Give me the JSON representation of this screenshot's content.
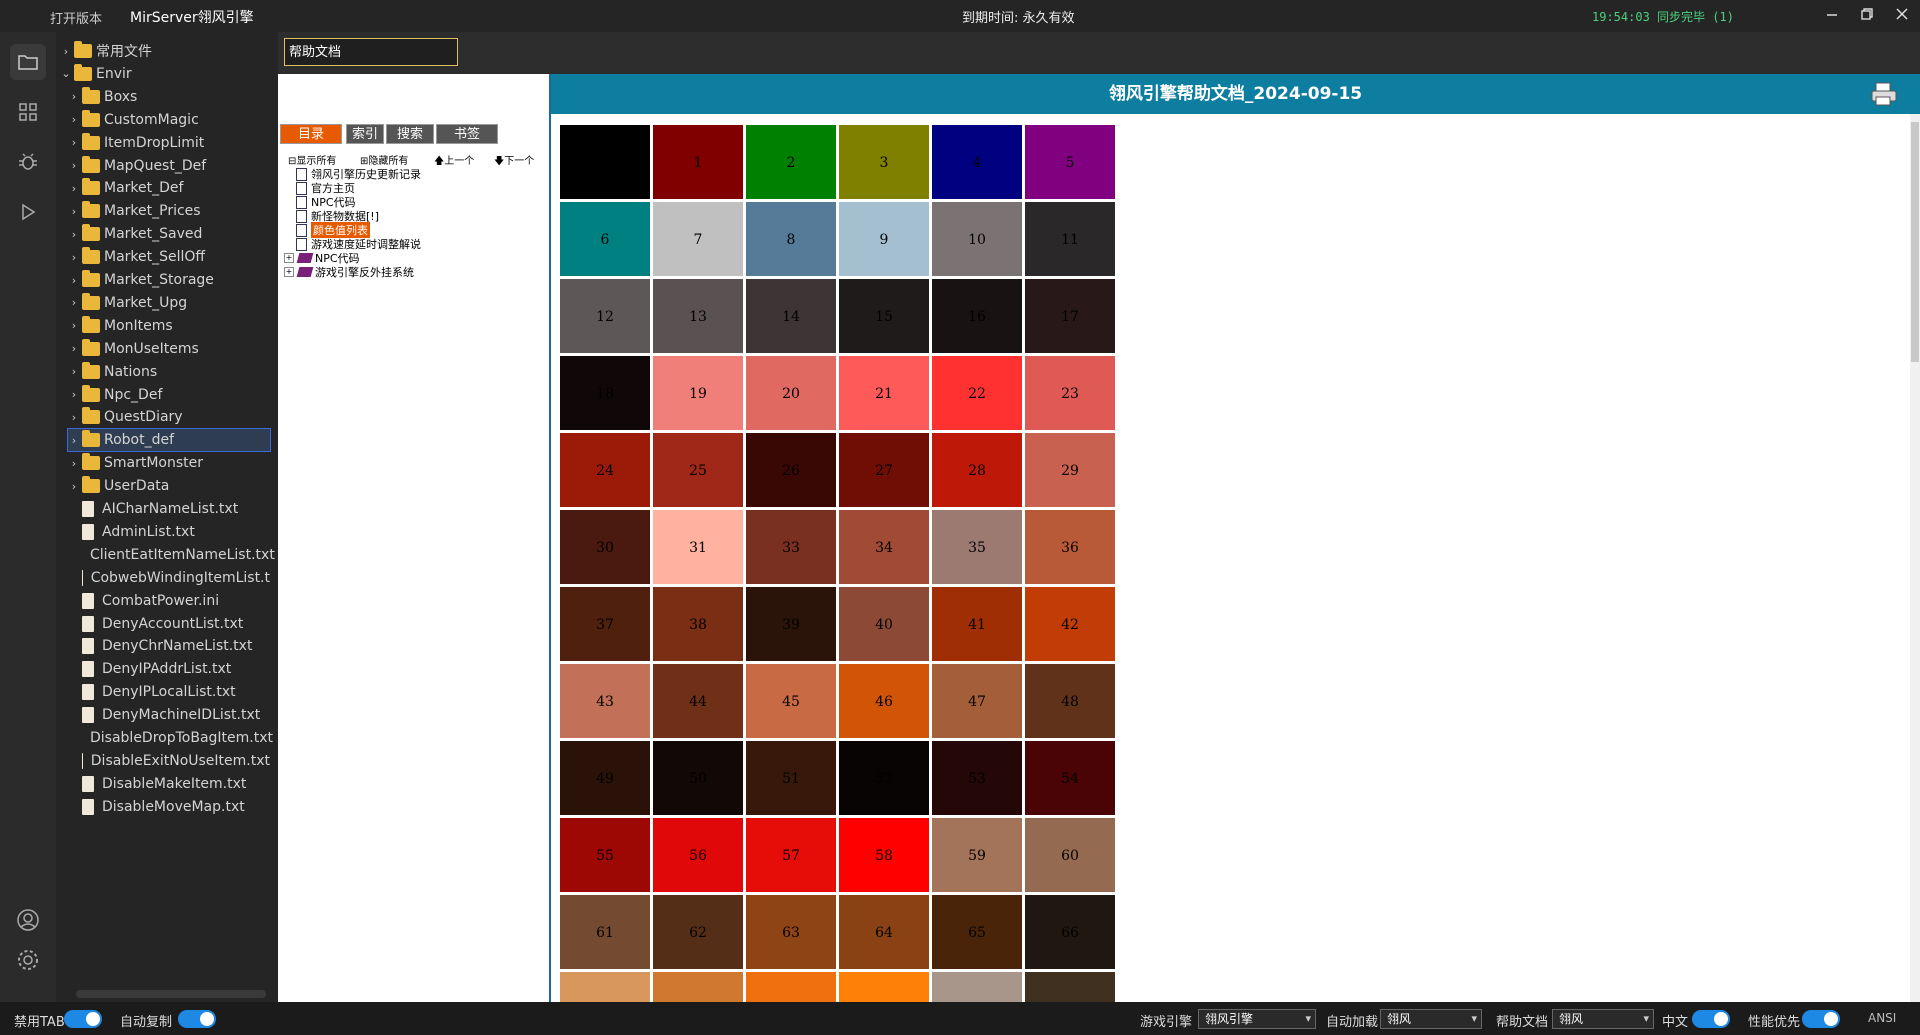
{
  "titlebar": {
    "open_version": "打开版本",
    "app_title": "MirServer翎风引擎",
    "expire": "到期时间: 永久有效",
    "sync_status": "19:54:03 同步完毕 (1)"
  },
  "explorer": {
    "items": [
      {
        "label": "常用文件",
        "type": "folder",
        "expanded": false,
        "depth": 0
      },
      {
        "label": "Envir",
        "type": "folder",
        "expanded": true,
        "depth": 0
      },
      {
        "label": "Boxs",
        "type": "folder",
        "depth": 1
      },
      {
        "label": "CustomMagic",
        "type": "folder",
        "depth": 1
      },
      {
        "label": "ItemDropLimit",
        "type": "folder",
        "depth": 1
      },
      {
        "label": "MapQuest_Def",
        "type": "folder",
        "depth": 1
      },
      {
        "label": "Market_Def",
        "type": "folder",
        "depth": 1
      },
      {
        "label": "Market_Prices",
        "type": "folder",
        "depth": 1
      },
      {
        "label": "Market_Saved",
        "type": "folder",
        "depth": 1
      },
      {
        "label": "Market_SellOff",
        "type": "folder",
        "depth": 1
      },
      {
        "label": "Market_Storage",
        "type": "folder",
        "depth": 1
      },
      {
        "label": "Market_Upg",
        "type": "folder",
        "depth": 1
      },
      {
        "label": "MonItems",
        "type": "folder",
        "depth": 1
      },
      {
        "label": "MonUseItems",
        "type": "folder",
        "depth": 1
      },
      {
        "label": "Nations",
        "type": "folder",
        "depth": 1
      },
      {
        "label": "Npc_Def",
        "type": "folder",
        "depth": 1
      },
      {
        "label": "QuestDiary",
        "type": "folder",
        "depth": 1
      },
      {
        "label": "Robot_def",
        "type": "folder",
        "depth": 1,
        "selected": true
      },
      {
        "label": "SmartMonster",
        "type": "folder",
        "depth": 1
      },
      {
        "label": "UserData",
        "type": "folder",
        "depth": 1
      },
      {
        "label": "AICharNameList.txt",
        "type": "file",
        "depth": 1
      },
      {
        "label": "AdminList.txt",
        "type": "file",
        "depth": 1
      },
      {
        "label": "ClientEatItemNameList.txt",
        "type": "file",
        "depth": 1
      },
      {
        "label": "CobwebWindingItemList.t",
        "type": "file",
        "depth": 1
      },
      {
        "label": "CombatPower.ini",
        "type": "file",
        "depth": 1
      },
      {
        "label": "DenyAccountList.txt",
        "type": "file",
        "depth": 1
      },
      {
        "label": "DenyChrNameList.txt",
        "type": "file",
        "depth": 1
      },
      {
        "label": "DenyIPAddrList.txt",
        "type": "file",
        "depth": 1
      },
      {
        "label": "DenyIPLocalList.txt",
        "type": "file",
        "depth": 1
      },
      {
        "label": "DenyMachineIDList.txt",
        "type": "file",
        "depth": 1
      },
      {
        "label": "DisableDropToBagItem.txt",
        "type": "file",
        "depth": 1
      },
      {
        "label": "DisableExitNoUseItem.txt",
        "type": "file",
        "depth": 1
      },
      {
        "label": "DisableMakeItem.txt",
        "type": "file",
        "depth": 1
      },
      {
        "label": "DisableMoveMap.txt",
        "type": "file",
        "depth": 1
      }
    ]
  },
  "help": {
    "tab_label": "帮助文档",
    "nav_tabs": [
      "目录",
      "索引",
      "搜索",
      "书签"
    ],
    "active_nav_tab": "目录",
    "tools": {
      "show_all": "显示所有",
      "hide_all": "隐藏所有",
      "prev": "上一个",
      "next": "下一个"
    },
    "toc": [
      {
        "label": "翎风引擎历史更新记录",
        "kind": "page"
      },
      {
        "label": "官方主页",
        "kind": "page"
      },
      {
        "label": "NPC代码",
        "kind": "page"
      },
      {
        "label": "新怪物数据[!]",
        "kind": "page"
      },
      {
        "label": "颜色值列表",
        "kind": "page",
        "highlighted": true
      },
      {
        "label": "游戏速度延时调整解说",
        "kind": "page"
      },
      {
        "label": "NPC代码",
        "kind": "book"
      },
      {
        "label": "游戏引擎反外挂系统",
        "kind": "book"
      }
    ],
    "doc_title": "翎风引擎帮助文档_2024-09-15",
    "colors": [
      {
        "n": "",
        "c": "#000000"
      },
      {
        "n": "1",
        "c": "#800000"
      },
      {
        "n": "2",
        "c": "#008000"
      },
      {
        "n": "3",
        "c": "#808000"
      },
      {
        "n": "4",
        "c": "#000080"
      },
      {
        "n": "5",
        "c": "#800080"
      },
      {
        "n": "6",
        "c": "#008080"
      },
      {
        "n": "7",
        "c": "#c0c0c0"
      },
      {
        "n": "8",
        "c": "#557b98"
      },
      {
        "n": "9",
        "c": "#a3bfd0"
      },
      {
        "n": "10",
        "c": "#7b7373"
      },
      {
        "n": "11",
        "c": "#2a2828"
      },
      {
        "n": "12",
        "c": "#5d5757"
      },
      {
        "n": "13",
        "c": "#5a5252"
      },
      {
        "n": "14",
        "c": "#3d3535"
      },
      {
        "n": "15",
        "c": "#1f1b1b"
      },
      {
        "n": "16",
        "c": "#181212"
      },
      {
        "n": "17",
        "c": "#281818"
      },
      {
        "n": "18",
        "c": "#100808"
      },
      {
        "n": "19",
        "c": "#f07f7a"
      },
      {
        "n": "20",
        "c": "#e06a62"
      },
      {
        "n": "21",
        "c": "#ff5a5a"
      },
      {
        "n": "22",
        "c": "#ff3131"
      },
      {
        "n": "23",
        "c": "#e05a55"
      },
      {
        "n": "24",
        "c": "#9c1a08"
      },
      {
        "n": "25",
        "c": "#a02818"
      },
      {
        "n": "26",
        "c": "#3a0804"
      },
      {
        "n": "27",
        "c": "#700e06"
      },
      {
        "n": "28",
        "c": "#be1808"
      },
      {
        "n": "29",
        "c": "#c8614f"
      },
      {
        "n": "30",
        "c": "#4a1910"
      },
      {
        "n": "31",
        "c": "#ffb2a0"
      },
      {
        "n": "33",
        "c": "#7a3020"
      },
      {
        "n": "34",
        "c": "#a14a36"
      },
      {
        "n": "35",
        "c": "#9c7a72"
      },
      {
        "n": "36",
        "c": "#b85a38"
      },
      {
        "n": "37",
        "c": "#50200e"
      },
      {
        "n": "38",
        "c": "#7a2e14"
      },
      {
        "n": "39",
        "c": "#2a140a"
      },
      {
        "n": "40",
        "c": "#8c4a36"
      },
      {
        "n": "41",
        "c": "#a02e04"
      },
      {
        "n": "42",
        "c": "#c23c06"
      },
      {
        "n": "43",
        "c": "#c27058"
      },
      {
        "n": "44",
        "c": "#703018"
      },
      {
        "n": "45",
        "c": "#c86a44"
      },
      {
        "n": "46",
        "c": "#d25406"
      },
      {
        "n": "47",
        "c": "#a45e3a"
      },
      {
        "n": "48",
        "c": "#60321a"
      },
      {
        "n": "49",
        "c": "#2a1208"
      },
      {
        "n": "50",
        "c": "#120806"
      },
      {
        "n": "51",
        "c": "#38180a"
      },
      {
        "n": "52",
        "c": "#080404"
      },
      {
        "n": "53",
        "c": "#240808"
      },
      {
        "n": "54",
        "c": "#4a0406"
      },
      {
        "n": "55",
        "c": "#9e0804"
      },
      {
        "n": "56",
        "c": "#e00808"
      },
      {
        "n": "57",
        "c": "#e60c08"
      },
      {
        "n": "58",
        "c": "#ff0000"
      },
      {
        "n": "59",
        "c": "#a4745a"
      },
      {
        "n": "60",
        "c": "#946a50"
      },
      {
        "n": "61",
        "c": "#744a30"
      },
      {
        "n": "62",
        "c": "#552e18"
      },
      {
        "n": "63",
        "c": "#8e4414"
      },
      {
        "n": "64",
        "c": "#8a4214"
      },
      {
        "n": "65",
        "c": "#4a2408"
      },
      {
        "n": "66",
        "c": "#201810"
      },
      {
        "n": "",
        "c": "#d8985c"
      },
      {
        "n": "",
        "c": "#d07830"
      },
      {
        "n": "",
        "c": "#f07010"
      },
      {
        "n": "",
        "c": "#ff8008"
      },
      {
        "n": "",
        "c": "#a8968a"
      },
      {
        "n": "",
        "c": "#403020"
      }
    ]
  },
  "status": {
    "disable_tab": "禁用TAB",
    "auto_copy": "自动复制",
    "engine_label": "游戏引擎",
    "engine_value": "翎风引擎",
    "autoload_label": "自动加载",
    "autoload_value": "翎风",
    "helpdoc_label": "帮助文档",
    "helpdoc_value": "翎风",
    "chinese": "中文",
    "perf_priority": "性能优先",
    "encoding": "ANSI"
  }
}
